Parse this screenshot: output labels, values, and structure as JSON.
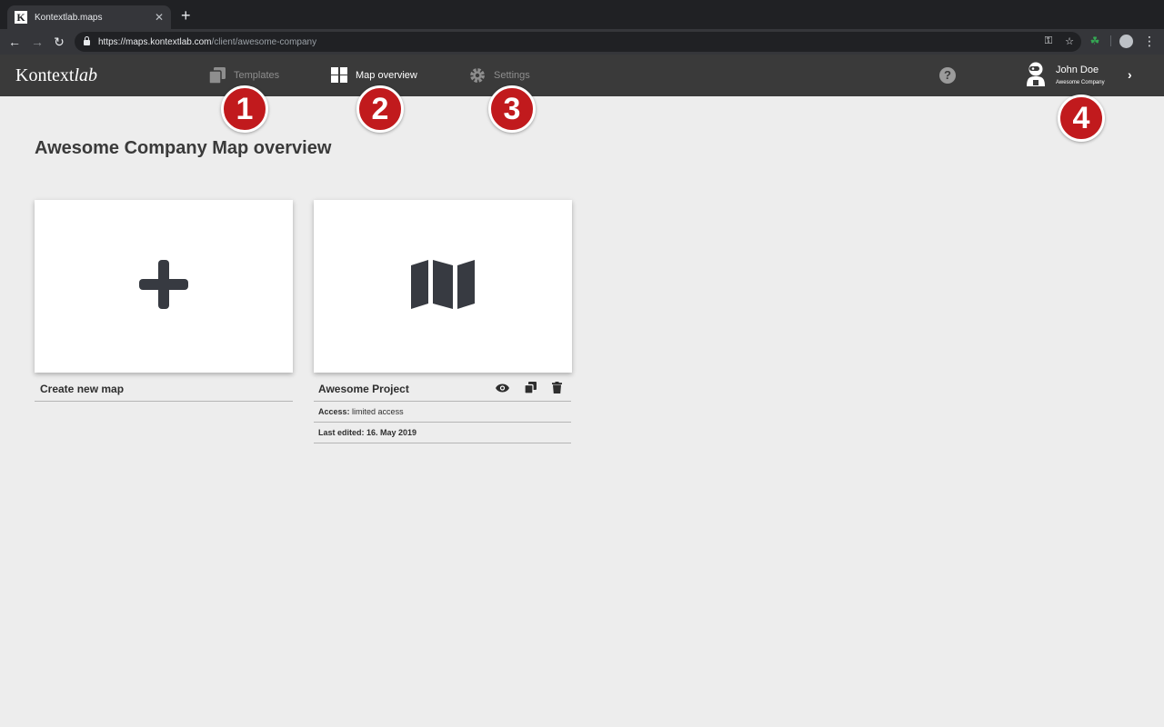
{
  "browser": {
    "tab_title": "Kontextlab.maps",
    "favicon_letter": "K",
    "url_host": "https://maps.kontextlab.com",
    "url_path": "/client/awesome-company"
  },
  "header": {
    "logo_main": "Kontext",
    "logo_italic": "lab",
    "nav": {
      "templates": "Templates",
      "map_overview": "Map overview",
      "settings": "Settings"
    },
    "user": {
      "name": "John Doe",
      "company": "Awesome Company"
    }
  },
  "badges": [
    "1",
    "2",
    "3",
    "4"
  ],
  "main": {
    "title": "Awesome Company Map overview",
    "create_card": {
      "label": "Create new map"
    },
    "project_card": {
      "name": "Awesome Project",
      "access_label": "Access:",
      "access_value": "limited access",
      "last_edited": "Last edited: 16. May 2019"
    }
  },
  "colors": {
    "appbar": "#3a3a3a",
    "background": "#ededed",
    "badge": "#c11a1d",
    "icon_dark": "#373a41"
  }
}
